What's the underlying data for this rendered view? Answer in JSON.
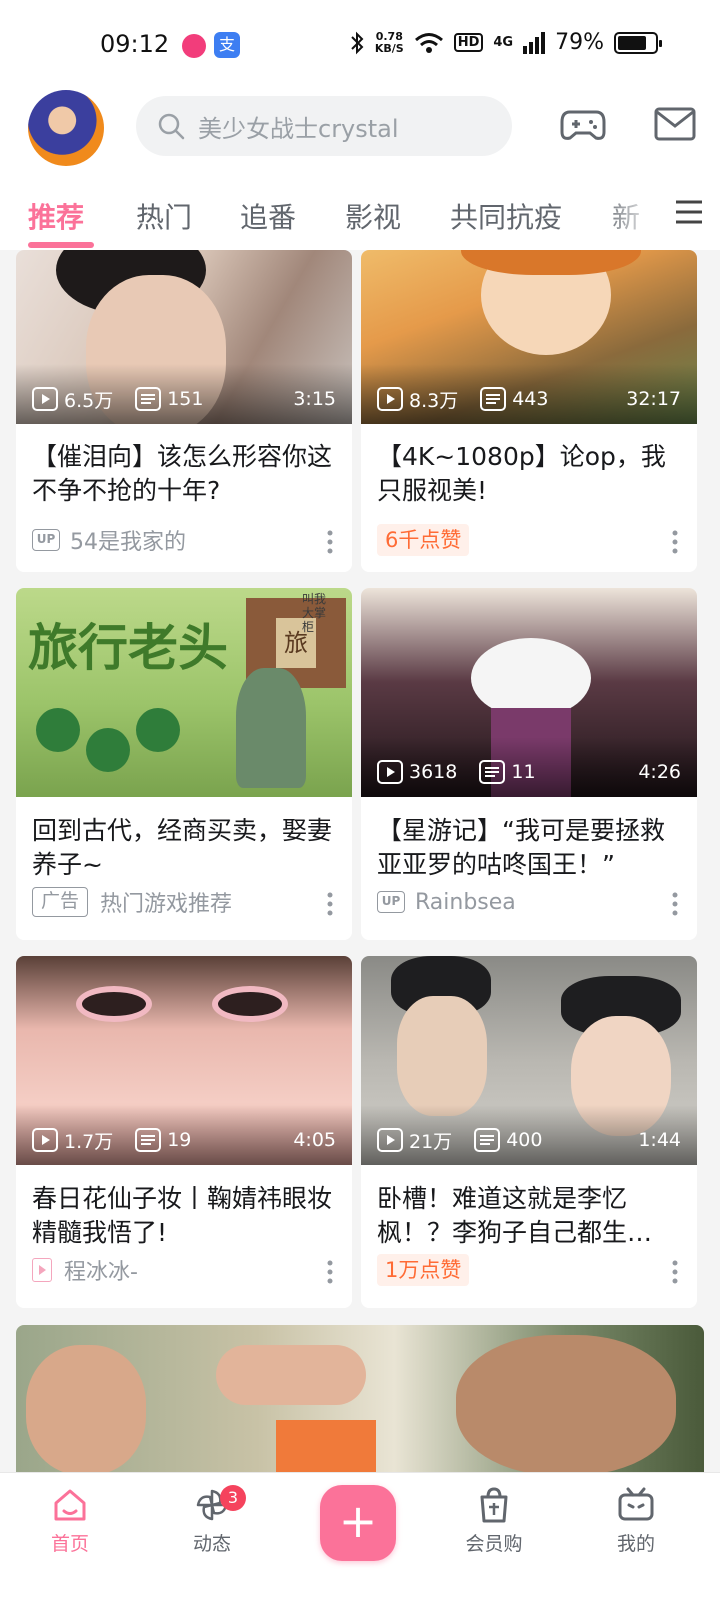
{
  "status_bar": {
    "time": "09:12",
    "app_badge": "支",
    "net_speed_value": "0.78",
    "net_speed_unit": "KB/S",
    "hd": "HD",
    "signal": "4G",
    "battery": "79%",
    "battery_level": 0.79
  },
  "header": {
    "search_placeholder": "美少女战士crystal"
  },
  "tabs": [
    {
      "label": "推荐",
      "active": true
    },
    {
      "label": "热门"
    },
    {
      "label": "追番"
    },
    {
      "label": "影视"
    },
    {
      "label": "共同抗疫"
    },
    {
      "label": "新"
    }
  ],
  "cards": [
    {
      "plays": "6.5万",
      "danmaku": "151",
      "duration": "3:15",
      "title": "【催泪向】该怎么形容你这不争不抢的十年?",
      "up_badge": "UP",
      "author": "54是我家的"
    },
    {
      "plays": "8.3万",
      "danmaku": "443",
      "duration": "32:17",
      "title": "【4K~1080p】论op，我只服视美!",
      "likes": "6千点赞"
    },
    {
      "title": "回到古代，经商买卖，娶妻养子~",
      "ad_badge": "广告",
      "author": "热门游戏推荐",
      "thumb_text": "旅行老头",
      "thumb_sign": "旅",
      "thumb_corner": "叫我大掌柜"
    },
    {
      "plays": "3618",
      "danmaku": "11",
      "duration": "4:26",
      "title": "【星游记】“我可是要拯救亚亚罗的咕咚国王！”",
      "up_badge": "UP",
      "author": "Rainbsea"
    },
    {
      "plays": "1.7万",
      "danmaku": "19",
      "duration": "4:05",
      "title": "春日花仙子妆丨鞠婧祎眼妆精髓我悟了!",
      "author": "程冰冰-"
    },
    {
      "plays": "21万",
      "danmaku": "400",
      "duration": "1:44",
      "title": "卧槽！难道这就是李忆枫！？李狗子自己都生…",
      "likes": "1万点赞"
    }
  ],
  "bottom_nav": {
    "home": "首页",
    "dynamic": "动态",
    "dynamic_badge": "3",
    "plus": "+",
    "vip_shop": "会员购",
    "mine": "我的"
  },
  "colors": {
    "accent": "#fb7299",
    "like": "#ff6b35"
  }
}
